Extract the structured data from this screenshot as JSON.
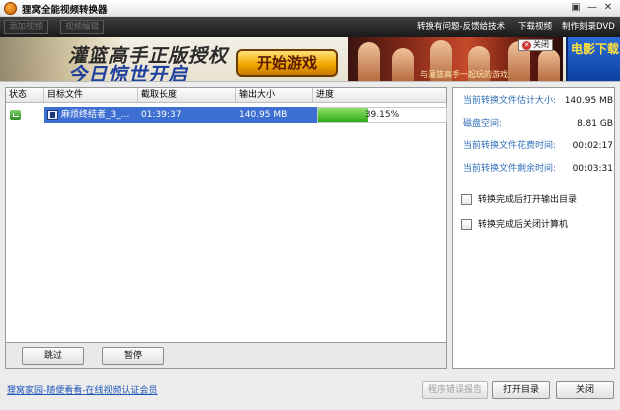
{
  "window": {
    "title": "狸窝全能视频转换器",
    "controls": [
      "▣",
      "—",
      "✕"
    ]
  },
  "toolbar": {
    "add_video": "添加视频",
    "video_edit": "视频编辑",
    "feedback": "转换有问题-反馈给技术",
    "download_video": "下载视频",
    "burn_dvd": "制作刻录DVD"
  },
  "banner": {
    "headline_top": "灌篮高手正版授权",
    "headline_main": "今日惊世开启",
    "cta": "开始游戏",
    "subtitle": "与灌篮高手一起玩的游戏",
    "close": "关闭",
    "side_ad": "电影下载"
  },
  "task_list": {
    "columns": [
      "状态",
      "目标文件",
      "截取长度",
      "输出大小",
      "进度"
    ],
    "rows": [
      {
        "status": "converting",
        "target_file": "麻烦终结者_3_...",
        "duration": "01:39:37",
        "output_size": "140.95 MB",
        "progress_text": "39.15%",
        "progress": 0.3915
      }
    ],
    "skip_button": "跳过",
    "pause_button": "暂停"
  },
  "info_panel": {
    "items": [
      {
        "label": "当前转换文件估计大小:",
        "value": "140.95 MB"
      },
      {
        "label": "磁盘空间:",
        "value": "8.81 GB"
      },
      {
        "label": "当前转换文件花费时间:",
        "value": "00:02:17"
      },
      {
        "label": "当前转换文件剩余时间:",
        "value": "00:03:31"
      }
    ],
    "options": [
      {
        "label": "转换完成后打开输出目录",
        "checked": false
      },
      {
        "label": "转换完成后关闭计算机",
        "checked": false
      }
    ]
  },
  "footer": {
    "link": "狸窝家园-随便看看-在线视频认证会员",
    "report_button": "程序错误报告",
    "open_dir_button": "打开目录",
    "close_button": "关闭"
  },
  "colors": {
    "selection": "#3d6ed1",
    "progress": "#2faa18",
    "link": "#1f56b8",
    "info_label": "#2e6fb8",
    "toolbar_bg": "#1a1a1a"
  }
}
